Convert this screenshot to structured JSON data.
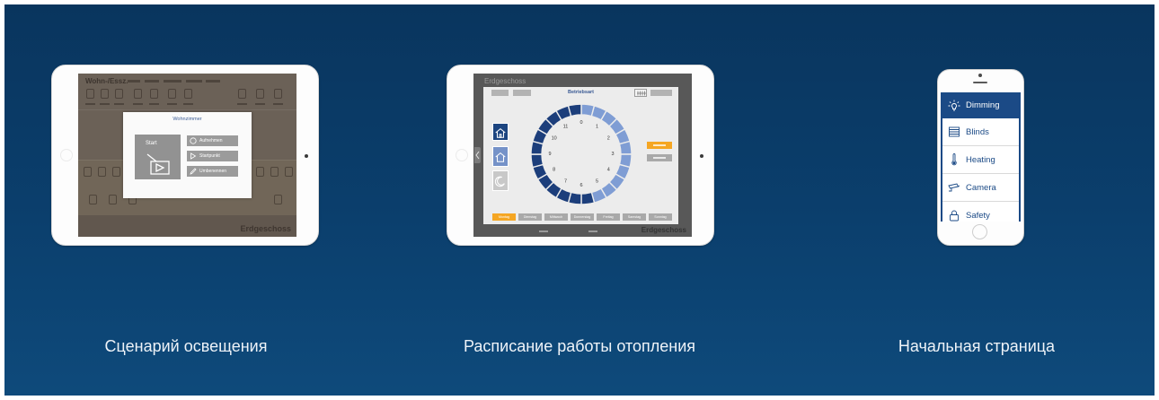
{
  "captions": {
    "lighting_scene": "Сценарий освещения",
    "heating_schedule": "Расписание работы отопления",
    "home_page": "Начальная страница"
  },
  "colors": {
    "background_top": "#09355e",
    "background_bottom": "#0e4a7b",
    "navy": "#1b4a86",
    "orange": "#f5a623",
    "segment_light": "#7f9dd4",
    "segment_dark": "#1c3e7b"
  },
  "scene_screen": {
    "room_title": "Wohn-/Essz.",
    "floor_label": "Erdgeschoss",
    "dialog": {
      "title": "Wohnzimmer",
      "start_label": "Start",
      "start_icon": "play-scene-icon",
      "buttons": [
        {
          "label": "Aufnehmen",
          "icon": "record-icon"
        },
        {
          "label": "Startpunkt",
          "icon": "play-icon"
        },
        {
          "label": "Umbenennen",
          "icon": "pencil-icon"
        }
      ]
    }
  },
  "heating_screen": {
    "floor_label": "Erdgeschoss",
    "title": "Betriebsart",
    "mode_tiles": [
      {
        "icon": "house-icon",
        "selected": true,
        "enabled": true
      },
      {
        "icon": "house-icon",
        "selected": false,
        "enabled": true
      },
      {
        "icon": "moon-icon",
        "selected": false,
        "enabled": false
      }
    ],
    "hour_labels": [
      "0",
      "1",
      "2",
      "3",
      "4",
      "5",
      "6",
      "7",
      "8",
      "9",
      "10",
      "11"
    ],
    "segment_levels": [
      1,
      1,
      1,
      1,
      1,
      1,
      1,
      1,
      1,
      1,
      1,
      0,
      0,
      0,
      0,
      0,
      0,
      0,
      0,
      0,
      0,
      0,
      0,
      0
    ],
    "active_range_index": 0,
    "days": [
      "Montag",
      "Dienstag",
      "Mittwoch",
      "Donnerstag",
      "Freitag",
      "Samstag",
      "Sonntag"
    ],
    "selected_day_index": 0,
    "footer_label": "Erdgeschoss"
  },
  "home_screen": {
    "menu": [
      {
        "label": "Dimming",
        "icon": "lightbulb-icon",
        "selected": true
      },
      {
        "label": "Blinds",
        "icon": "blinds-icon",
        "selected": false
      },
      {
        "label": "Heating",
        "icon": "thermometer-icon",
        "selected": false
      },
      {
        "label": "Camera",
        "icon": "camera-icon",
        "selected": false
      },
      {
        "label": "Safety",
        "icon": "padlock-icon",
        "selected": false
      }
    ]
  }
}
